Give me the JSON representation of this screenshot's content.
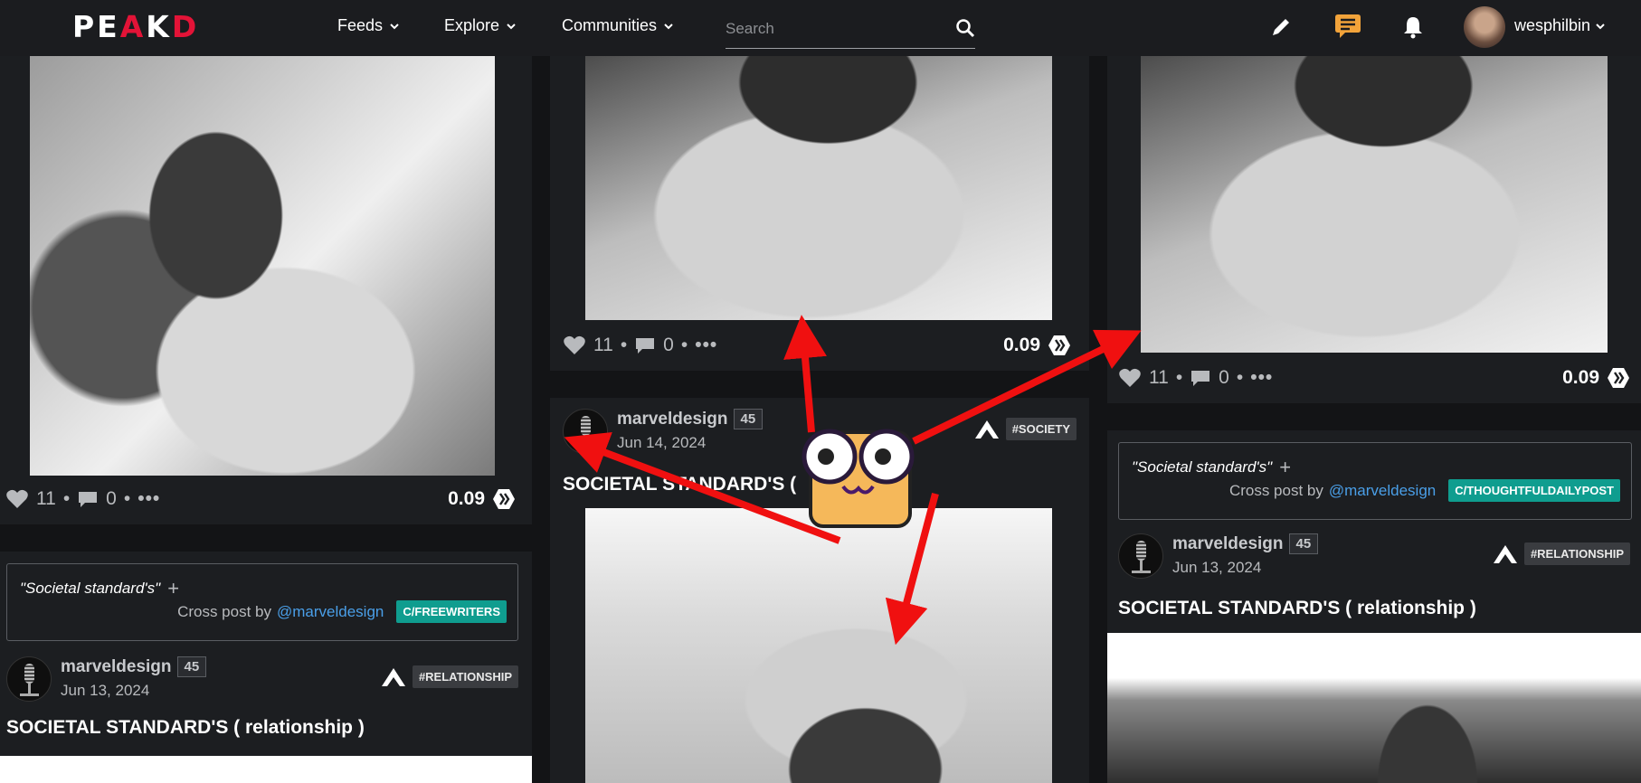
{
  "header": {
    "logo": {
      "part1": "PE",
      "part2": "A",
      "part3": "K",
      "part4": "D"
    },
    "nav": [
      {
        "label": "Feeds"
      },
      {
        "label": "Explore"
      },
      {
        "label": "Communities"
      }
    ],
    "search": {
      "placeholder": "Search",
      "value": ""
    },
    "icons": [
      "pencil-icon",
      "chat-icon",
      "bell-icon"
    ],
    "username": "wesphilbin"
  },
  "colors": {
    "bg": "#131416",
    "card": "#1c1e21",
    "brand": "#e31337",
    "tag_teal": "#0f9d8f",
    "link": "#4a9fe8",
    "arrow": "#f01010"
  },
  "cards": {
    "left_top": {
      "votes": "11",
      "comments": "0",
      "payout": "0.09"
    },
    "mid_top": {
      "votes": "11",
      "comments": "0",
      "payout": "0.09"
    },
    "right_top": {
      "votes": "11",
      "comments": "0",
      "payout": "0.09"
    },
    "left_post": {
      "cross_title": "\"Societal standard's\"",
      "cross_by": "Cross post by",
      "cross_author": "@marveldesign",
      "cross_tag": "C/FREEWRITERS",
      "author": "marveldesign",
      "reputation": "45",
      "date": "Jun 13, 2024",
      "community": "#RELATIONSHIP",
      "title": "SOCIETAL STANDARD'S ( relationship )"
    },
    "mid_post": {
      "author": "marveldesign",
      "reputation": "45",
      "date": "Jun 14, 2024",
      "community": "#SOCIETY",
      "title": "SOCIETAL STANDARD'S ("
    },
    "right_post": {
      "cross_title": "\"Societal standard's\"",
      "cross_by": "Cross post by",
      "cross_author": "@marveldesign",
      "cross_tag": "C/THOUGHTFULDAILYPOST",
      "author": "marveldesign",
      "reputation": "45",
      "date": "Jun 13, 2024",
      "community": "#RELATIONSHIP",
      "title": "SOCIETAL STANDARD'S ( relationship )"
    }
  }
}
